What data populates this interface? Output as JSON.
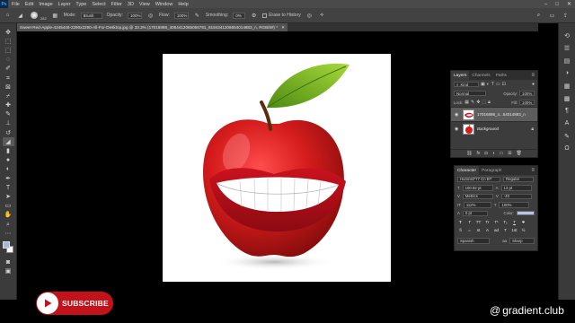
{
  "menubar": {
    "logo": "Ps",
    "items": [
      "File",
      "Edit",
      "Image",
      "Layer",
      "Type",
      "Select",
      "Filter",
      "3D",
      "View",
      "Window",
      "Help"
    ]
  },
  "options": {
    "brush_size": "282",
    "mode_label": "Mode:",
    "mode_value": "Brush",
    "opacity_label": "Opacity:",
    "opacity_value": "100%",
    "flow_label": "Flow:",
    "flow_value": "100%",
    "smoothing_label": "Smoothing:",
    "smoothing_value": "0%",
    "erase_history": "Erase to History"
  },
  "document": {
    "tab_title": "Sweet-Red-Apple-4245448-2290x2290-All-For-Desktop.jpg @ 33.3% (17016898_4064412065056781_8184341206654014883_n, RGB/8#) *"
  },
  "layers_panel": {
    "tabs": [
      "Layers",
      "Channels",
      "Paths"
    ],
    "kind_label": "Kind",
    "blend_mode": "Normal",
    "opacity_label": "Opacity:",
    "opacity_value": "100%",
    "lock_label": "Lock:",
    "fill_label": "Fill:",
    "fill_value": "100%",
    "layers": [
      {
        "name": "17016898_4...54014883_n",
        "selected": true
      },
      {
        "name": "Background",
        "selected": false
      }
    ]
  },
  "character_panel": {
    "tabs": [
      "Character",
      "Paragraph"
    ],
    "font_family": "Humnst777 Cn BT",
    "font_style": "Regular",
    "font_size": "100.92 pt",
    "leading": "13 pt",
    "kerning": "Metrics",
    "tracking": "-40",
    "vertical_scale": "112%",
    "horizontal_scale": "100%",
    "baseline": "0 pt",
    "color_label": "Color:",
    "text_color": "#b5c3ef",
    "glyph_buttons": [
      "T",
      "T",
      "TT",
      "Tr",
      "T¹",
      "T₁",
      "T",
      "T"
    ],
    "extra_buttons": [
      "fi",
      "ℴ",
      "st",
      "A",
      "ad",
      "T",
      "1st",
      "½"
    ],
    "language": "Spanish",
    "anti_alias": "Sharp"
  },
  "overlay": {
    "subscribe_label": "SUBSCRIBE",
    "watermark": "gradient.club"
  },
  "colors": {
    "foreground": "#a9b6d6",
    "background": "#ffffff"
  },
  "icons": {
    "toolbar": [
      "move-icon",
      "artboard-icon",
      "marquee-icon",
      "lasso-icon",
      "quick-select-icon",
      "crop-icon",
      "frame-icon",
      "eyedropper-icon",
      "healing-icon",
      "brush-icon",
      "clone-stamp-icon",
      "history-brush-icon",
      "eraser-icon",
      "gradient-icon",
      "blur-icon",
      "dodge-icon",
      "pen-icon",
      "type-icon",
      "path-select-icon",
      "rectangle-icon",
      "hand-icon",
      "zoom-icon",
      "more-tools-icon"
    ],
    "dock": [
      "history-icon",
      "properties-icon",
      "libraries-icon",
      "adjustments-icon",
      "styles-icon",
      "swatches-icon",
      "paragraph-icon",
      "character-icon",
      "brushes-icon",
      "glyphs-icon"
    ]
  }
}
